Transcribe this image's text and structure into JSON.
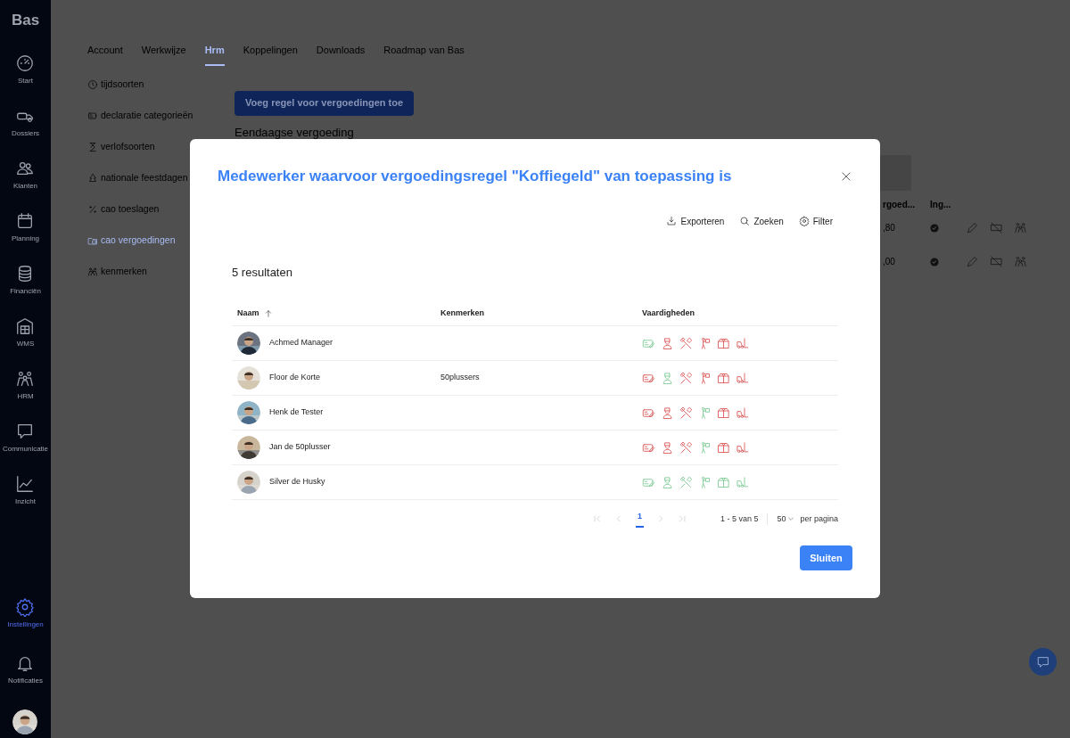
{
  "sidebar": {
    "logo": "Bas",
    "items": [
      {
        "label": "Start",
        "selected": false
      },
      {
        "label": "Dossiers",
        "selected": false
      },
      {
        "label": "Klanten",
        "selected": false
      },
      {
        "label": "Planning",
        "selected": false
      },
      {
        "label": "Financiën",
        "selected": false
      },
      {
        "label": "WMS",
        "selected": false
      },
      {
        "label": "HRM",
        "selected": false
      },
      {
        "label": "Communicatie",
        "selected": false
      },
      {
        "label": "Inzicht",
        "selected": false
      }
    ],
    "bottom_items": [
      {
        "label": "Instellingen",
        "selected": true
      },
      {
        "label": "Notificaties",
        "selected": false
      }
    ]
  },
  "tabs": [
    {
      "label": "Account",
      "selected": false
    },
    {
      "label": "Werkwijze",
      "selected": false
    },
    {
      "label": "Hrm",
      "selected": true
    },
    {
      "label": "Koppelingen",
      "selected": false
    },
    {
      "label": "Downloads",
      "selected": false
    },
    {
      "label": "Roadmap van Bas",
      "selected": false
    }
  ],
  "settings_menu": [
    {
      "label": "tijdsoorten",
      "selected": false
    },
    {
      "label": "declaratie categorieën",
      "selected": false
    },
    {
      "label": "verlofsoorten",
      "selected": false
    },
    {
      "label": "nationale feestdagen",
      "selected": false
    },
    {
      "label": "cao toeslagen",
      "selected": false
    },
    {
      "label": "cao vergoedingen",
      "selected": true
    },
    {
      "label": "kenmerken",
      "selected": false
    }
  ],
  "add_button": "Voeg regel voor vergoedingen toe",
  "section_heading": "Eendaagse vergoeding",
  "background_table": {
    "columns": [
      "rgoed...",
      "Ing..."
    ],
    "rows": [
      {
        "amount": ",80",
        "included": true
      },
      {
        "amount": ",00",
        "included": true
      }
    ]
  },
  "modal": {
    "title": "Medewerker waarvoor vergoedingsregel \"Koffiegeld\" van toepassing is",
    "toolbar": [
      "Exporteren",
      "Zoeken",
      "Filter"
    ],
    "result_count": "5 resultaten",
    "columns": [
      {
        "label": "Naam",
        "sorted": true
      },
      {
        "label": "Kenmerken",
        "sorted": false
      },
      {
        "label": "Vaardigheden",
        "sorted": false
      }
    ],
    "rows": [
      {
        "name": "Achmed Manager",
        "kenmerken": "",
        "skills": [
          {
            "kind": "expense",
            "has": true
          },
          {
            "kind": "person",
            "has": false
          },
          {
            "kind": "tools",
            "has": false
          },
          {
            "kind": "worker",
            "has": false
          },
          {
            "kind": "box",
            "has": false
          },
          {
            "kind": "forklift",
            "has": false
          }
        ]
      },
      {
        "name": "Floor de Korte",
        "kenmerken": "50plussers",
        "skills": [
          {
            "kind": "expense",
            "has": false
          },
          {
            "kind": "person",
            "has": true
          },
          {
            "kind": "tools",
            "has": false
          },
          {
            "kind": "worker",
            "has": false
          },
          {
            "kind": "box",
            "has": false
          },
          {
            "kind": "forklift",
            "has": false
          }
        ]
      },
      {
        "name": "Henk de Tester",
        "kenmerken": "",
        "skills": [
          {
            "kind": "expense",
            "has": false
          },
          {
            "kind": "person",
            "has": false
          },
          {
            "kind": "tools",
            "has": false
          },
          {
            "kind": "worker",
            "has": true
          },
          {
            "kind": "box",
            "has": false
          },
          {
            "kind": "forklift",
            "has": false
          }
        ]
      },
      {
        "name": "Jan de 50plusser",
        "kenmerken": "",
        "skills": [
          {
            "kind": "expense",
            "has": false
          },
          {
            "kind": "person",
            "has": false
          },
          {
            "kind": "tools",
            "has": false
          },
          {
            "kind": "worker",
            "has": true
          },
          {
            "kind": "box",
            "has": false
          },
          {
            "kind": "forklift",
            "has": false
          }
        ]
      },
      {
        "name": "Silver de Husky",
        "kenmerken": "",
        "skills": [
          {
            "kind": "expense",
            "has": true
          },
          {
            "kind": "person",
            "has": true
          },
          {
            "kind": "tools",
            "has": true
          },
          {
            "kind": "worker",
            "has": true
          },
          {
            "kind": "box",
            "has": true
          },
          {
            "kind": "forklift",
            "has": true
          }
        ]
      }
    ],
    "pagination": {
      "pages": [
        {
          "label": "1",
          "selected": true
        }
      ],
      "range": "1 - 5 van 5",
      "page_size": "50",
      "page_size_label": "per pagina"
    },
    "close_button": "Sluiten"
  }
}
